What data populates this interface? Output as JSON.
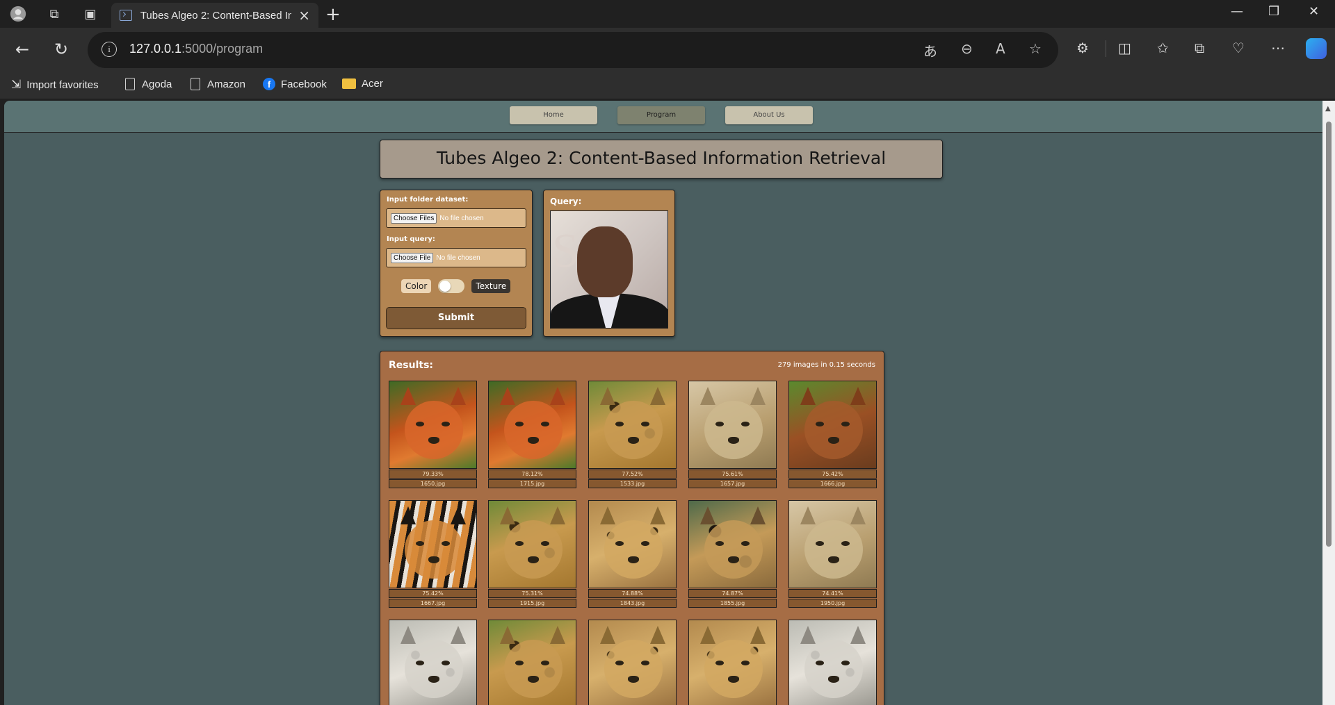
{
  "browser": {
    "tab_title": "Tubes Algeo 2: Content-Based In",
    "url_host": "127.0.0.1",
    "url_path": ":5000/program",
    "bookmarks": [
      "Import favorites",
      "Agoda",
      "Amazon",
      "Facebook",
      "Acer"
    ]
  },
  "site": {
    "nav": [
      "Home",
      "Program",
      "About Us"
    ],
    "active_nav": "Program",
    "title": "Tubes Algeo 2: Content-Based Information Retrieval"
  },
  "form": {
    "dataset_label": "Input folder dataset:",
    "dataset_button": "Choose Files",
    "dataset_status": "No file chosen",
    "query_label": "Input query:",
    "query_button": "Choose File",
    "query_status": "No file chosen",
    "toggle_left": "Color",
    "toggle_right": "Texture",
    "submit": "Submit"
  },
  "query_card": {
    "label": "Query:",
    "image": "man-portrait"
  },
  "results": {
    "title": "Results:",
    "stats": "279 images in 0.15 seconds",
    "items": [
      {
        "score": "79.33%",
        "file": "1650.jpg",
        "image": "fox"
      },
      {
        "score": "78.12%",
        "file": "1715.jpg",
        "image": "fox"
      },
      {
        "score": "77.52%",
        "file": "1533.jpg",
        "image": "leopard"
      },
      {
        "score": "75.61%",
        "file": "1657.jpg",
        "image": "cheetah-cub"
      },
      {
        "score": "75.42%",
        "file": "1666.jpg",
        "image": "fox-cub"
      },
      {
        "score": "75.42%",
        "file": "1667.jpg",
        "image": "tiger"
      },
      {
        "score": "75.31%",
        "file": "1915.jpg",
        "image": "leopard"
      },
      {
        "score": "74.88%",
        "file": "1843.jpg",
        "image": "cheetah"
      },
      {
        "score": "74.87%",
        "file": "1855.jpg",
        "image": "jaguar"
      },
      {
        "score": "74.41%",
        "file": "1950.jpg",
        "image": "cheetah-cub"
      },
      {
        "score": "",
        "file": "",
        "image": "snow-leopard"
      },
      {
        "score": "",
        "file": "",
        "image": "leopard"
      },
      {
        "score": "",
        "file": "",
        "image": "cheetah"
      },
      {
        "score": "",
        "file": "",
        "image": "cheetah"
      },
      {
        "score": "",
        "file": "",
        "image": "snow-leopard"
      }
    ]
  },
  "colors": {
    "page_bg": "#4a5e60",
    "nav_bg": "#5a7373",
    "card_bg": "#b38552",
    "results_bg": "#a66d45"
  }
}
